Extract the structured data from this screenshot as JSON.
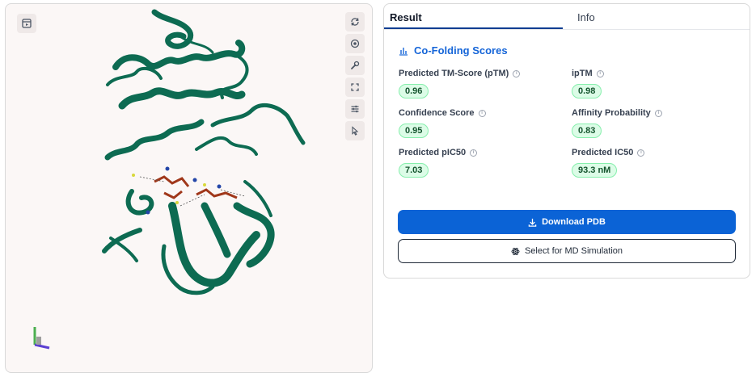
{
  "viewer": {
    "top_button_icon": "panel-toggle-icon",
    "tools": [
      {
        "name": "rotate-icon"
      },
      {
        "name": "center-icon"
      },
      {
        "name": "wrench-icon"
      },
      {
        "name": "fullscreen-icon"
      },
      {
        "name": "sliders-icon"
      },
      {
        "name": "pointer-icon"
      }
    ],
    "protein_color": "#0d6b52",
    "ligand_color": "#a0371a"
  },
  "tabs": [
    {
      "label": "Result",
      "active": true
    },
    {
      "label": "Info",
      "active": false
    }
  ],
  "section": {
    "title": "Co-Folding Scores",
    "icon": "bar-chart-icon"
  },
  "metrics": [
    {
      "label": "Predicted TM-Score (pTM)",
      "value": "0.96"
    },
    {
      "label": "ipTM",
      "value": "0.98"
    },
    {
      "label": "Confidence Score",
      "value": "0.95"
    },
    {
      "label": "Affinity Probability",
      "value": "0.83"
    },
    {
      "label": "Predicted pIC50",
      "value": "7.03"
    },
    {
      "label": "Predicted IC50",
      "value": "93.3 nM"
    }
  ],
  "actions": {
    "download_label": "Download PDB",
    "md_label": "Select for MD Simulation"
  },
  "colors": {
    "accent": "#0b63d6",
    "badge_bg": "#dcfce7",
    "badge_border": "#86efac"
  }
}
